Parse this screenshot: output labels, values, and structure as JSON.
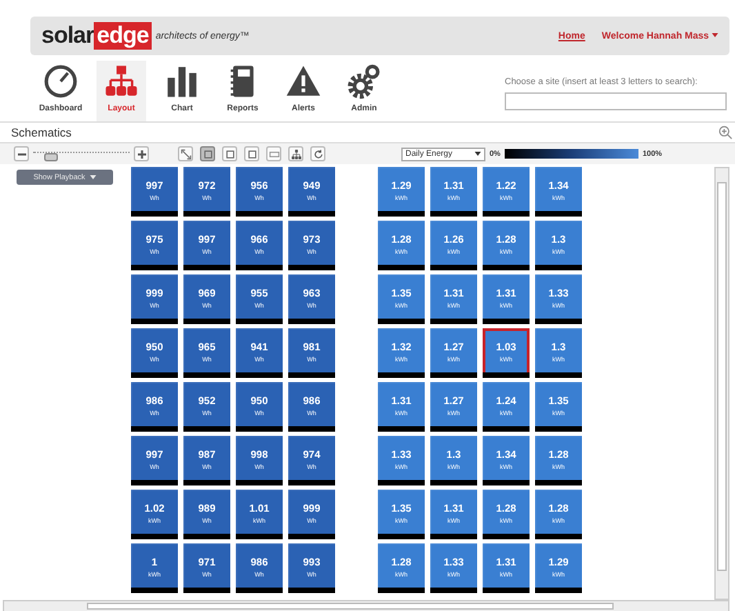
{
  "header": {
    "logo_main": "solar",
    "logo_box": "edge",
    "tagline": "architects of energy™",
    "home_link": "Home",
    "user_link": "Welcome Hannah Mass"
  },
  "nav": [
    {
      "label": "Dashboard",
      "kind": "gauge",
      "selected": false
    },
    {
      "label": "Layout",
      "kind": "tree",
      "selected": true
    },
    {
      "label": "Chart",
      "kind": "bars",
      "selected": false
    },
    {
      "label": "Reports",
      "kind": "notebook",
      "selected": false
    },
    {
      "label": "Alerts",
      "kind": "warning",
      "selected": false
    },
    {
      "label": "Admin",
      "kind": "gears",
      "selected": false
    }
  ],
  "site_search": {
    "label": "Choose a site (insert at least 3 letters to search):"
  },
  "section_title": "Schematics",
  "toolbar": {
    "level": 0.12,
    "tools": [
      {
        "kind": "fit",
        "selected": false
      },
      {
        "kind": "square",
        "selected": true
      },
      {
        "kind": "square",
        "selected": false
      },
      {
        "kind": "square",
        "selected": false
      },
      {
        "kind": "wide",
        "selected": false
      },
      {
        "kind": "tree",
        "selected": false
      },
      {
        "kind": "refresh",
        "selected": false
      }
    ],
    "metric": "Daily Energy",
    "scale_min": "0%",
    "scale_max": "100%"
  },
  "playback_button": "Show Playback",
  "groups": [
    {
      "color": "#2b62b4",
      "panels": [
        {
          "value": "997",
          "unit": "Wh",
          "selected": false
        },
        {
          "value": "972",
          "unit": "Wh",
          "selected": false
        },
        {
          "value": "956",
          "unit": "Wh",
          "selected": false
        },
        {
          "value": "949",
          "unit": "Wh",
          "selected": false
        },
        {
          "value": "975",
          "unit": "Wh",
          "selected": false
        },
        {
          "value": "997",
          "unit": "Wh",
          "selected": false
        },
        {
          "value": "966",
          "unit": "Wh",
          "selected": false
        },
        {
          "value": "973",
          "unit": "Wh",
          "selected": false
        },
        {
          "value": "999",
          "unit": "Wh",
          "selected": false
        },
        {
          "value": "969",
          "unit": "Wh",
          "selected": false
        },
        {
          "value": "955",
          "unit": "Wh",
          "selected": false
        },
        {
          "value": "963",
          "unit": "Wh",
          "selected": false
        },
        {
          "value": "950",
          "unit": "Wh",
          "selected": false
        },
        {
          "value": "965",
          "unit": "Wh",
          "selected": false
        },
        {
          "value": "941",
          "unit": "Wh",
          "selected": false
        },
        {
          "value": "981",
          "unit": "Wh",
          "selected": false
        },
        {
          "value": "986",
          "unit": "Wh",
          "selected": false
        },
        {
          "value": "952",
          "unit": "Wh",
          "selected": false
        },
        {
          "value": "950",
          "unit": "Wh",
          "selected": false
        },
        {
          "value": "986",
          "unit": "Wh",
          "selected": false
        },
        {
          "value": "997",
          "unit": "Wh",
          "selected": false
        },
        {
          "value": "987",
          "unit": "Wh",
          "selected": false
        },
        {
          "value": "998",
          "unit": "Wh",
          "selected": false
        },
        {
          "value": "974",
          "unit": "Wh",
          "selected": false
        },
        {
          "value": "1.02",
          "unit": "kWh",
          "selected": false
        },
        {
          "value": "989",
          "unit": "Wh",
          "selected": false
        },
        {
          "value": "1.01",
          "unit": "kWh",
          "selected": false
        },
        {
          "value": "999",
          "unit": "Wh",
          "selected": false
        },
        {
          "value": "1",
          "unit": "kWh",
          "selected": false
        },
        {
          "value": "971",
          "unit": "Wh",
          "selected": false
        },
        {
          "value": "986",
          "unit": "Wh",
          "selected": false
        },
        {
          "value": "993",
          "unit": "Wh",
          "selected": false
        }
      ]
    },
    {
      "color": "#3a7fd2",
      "panels": [
        {
          "value": "1.29",
          "unit": "kWh",
          "selected": false
        },
        {
          "value": "1.31",
          "unit": "kWh",
          "selected": false
        },
        {
          "value": "1.22",
          "unit": "kWh",
          "selected": false
        },
        {
          "value": "1.34",
          "unit": "kWh",
          "selected": false
        },
        {
          "value": "1.28",
          "unit": "kWh",
          "selected": false
        },
        {
          "value": "1.26",
          "unit": "kWh",
          "selected": false
        },
        {
          "value": "1.28",
          "unit": "kWh",
          "selected": false
        },
        {
          "value": "1.3",
          "unit": "kWh",
          "selected": false
        },
        {
          "value": "1.35",
          "unit": "kWh",
          "selected": false
        },
        {
          "value": "1.31",
          "unit": "kWh",
          "selected": false
        },
        {
          "value": "1.31",
          "unit": "kWh",
          "selected": false
        },
        {
          "value": "1.33",
          "unit": "kWh",
          "selected": false
        },
        {
          "value": "1.32",
          "unit": "kWh",
          "selected": false
        },
        {
          "value": "1.27",
          "unit": "kWh",
          "selected": false
        },
        {
          "value": "1.03",
          "unit": "kWh",
          "selected": true
        },
        {
          "value": "1.3",
          "unit": "kWh",
          "selected": false
        },
        {
          "value": "1.31",
          "unit": "kWh",
          "selected": false
        },
        {
          "value": "1.27",
          "unit": "kWh",
          "selected": false
        },
        {
          "value": "1.24",
          "unit": "kWh",
          "selected": false
        },
        {
          "value": "1.35",
          "unit": "kWh",
          "selected": false
        },
        {
          "value": "1.33",
          "unit": "kWh",
          "selected": false
        },
        {
          "value": "1.3",
          "unit": "kWh",
          "selected": false
        },
        {
          "value": "1.34",
          "unit": "kWh",
          "selected": false
        },
        {
          "value": "1.28",
          "unit": "kWh",
          "selected": false
        },
        {
          "value": "1.35",
          "unit": "kWh",
          "selected": false
        },
        {
          "value": "1.31",
          "unit": "kWh",
          "selected": false
        },
        {
          "value": "1.28",
          "unit": "kWh",
          "selected": false
        },
        {
          "value": "1.28",
          "unit": "kWh",
          "selected": false
        },
        {
          "value": "1.28",
          "unit": "kWh",
          "selected": false
        },
        {
          "value": "1.33",
          "unit": "kWh",
          "selected": false
        },
        {
          "value": "1.31",
          "unit": "kWh",
          "selected": false
        },
        {
          "value": "1.29",
          "unit": "kWh",
          "selected": false
        }
      ]
    }
  ]
}
